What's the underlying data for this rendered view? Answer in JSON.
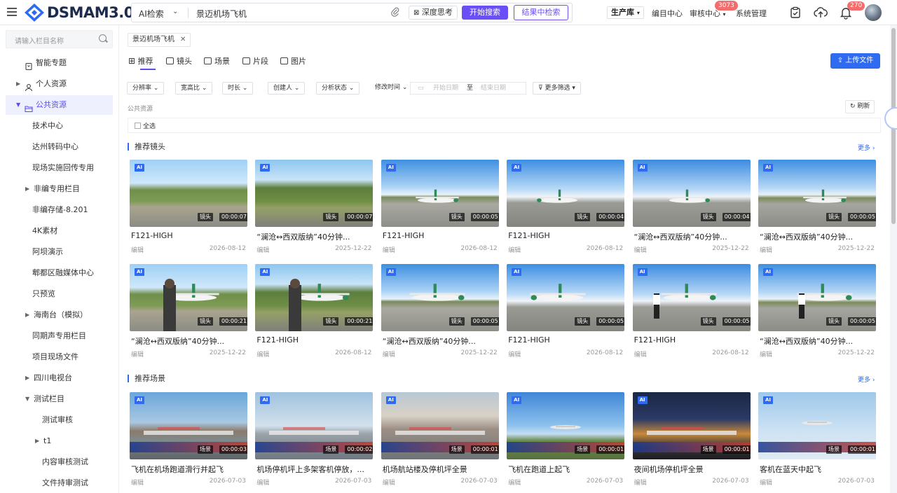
{
  "header": {
    "logo_text": "DSMAM3.0",
    "search_type": "AI检索",
    "search_value": "景迈机场飞机",
    "deep_think": "深度思考",
    "start_search": "开始搜索",
    "search_within": "结果中检索",
    "library": "生产库",
    "nav": [
      "编目中心",
      "审核中心",
      "系统管理"
    ],
    "audit_badge": "3073",
    "bell_badge": "270"
  },
  "sidebar": {
    "search_placeholder": "请输入栏目名称",
    "items": [
      {
        "label": "智能专题"
      },
      {
        "label": "个人资源"
      },
      {
        "label": "公共资源"
      },
      {
        "label": "技术中心"
      },
      {
        "label": "达州转码中心"
      },
      {
        "label": "现场实施回传专用"
      },
      {
        "label": "非编专用栏目"
      },
      {
        "label": "非编存储-8.201"
      },
      {
        "label": "4K素材"
      },
      {
        "label": "阿坝演示"
      },
      {
        "label": "郫都区融媒体中心"
      },
      {
        "label": "只预览"
      },
      {
        "label": "海南台（模拟）"
      },
      {
        "label": "同期声专用栏目"
      },
      {
        "label": "项目现场文件"
      },
      {
        "label": "四川电视台"
      },
      {
        "label": "测试栏目"
      },
      {
        "label": "测试审核"
      },
      {
        "label": "t1"
      },
      {
        "label": "内容审核测试"
      },
      {
        "label": "文件持审测试"
      }
    ]
  },
  "main": {
    "tag": "景迈机场飞机",
    "tabs": [
      "推荐",
      "镜头",
      "场景",
      "片段",
      "图片"
    ],
    "upload": "上传文件",
    "filters": [
      "分辨率",
      "宽高比",
      "时长",
      "创建人",
      "分析状态",
      "修改时间",
      "更多筛选"
    ],
    "date_start": "开始日期",
    "date_to": "至",
    "date_end": "结束日期",
    "crumb": "公共资源",
    "refresh": "刷新",
    "select_all": "全选",
    "more": "更多",
    "sections": [
      {
        "title": "推荐镜头",
        "cards": [
          {
            "title": "F121-HIGH",
            "user": "编辑",
            "date": "2026-08-12",
            "kind": "镜头",
            "duration": "00:00:07"
          },
          {
            "title": "“澜沧↔西双版纳”40分钟...",
            "user": "编辑",
            "date": "2025-12-22",
            "kind": "镜头",
            "duration": "00:00:07"
          },
          {
            "title": "F121-HIGH",
            "user": "编辑",
            "date": "2026-08-12",
            "kind": "镜头",
            "duration": "00:00:05"
          },
          {
            "title": "F121-HIGH",
            "user": "编辑",
            "date": "2026-08-12",
            "kind": "镜头",
            "duration": "00:00:04"
          },
          {
            "title": "“澜沧↔西双版纳”40分钟...",
            "user": "编辑",
            "date": "2025-12-22",
            "kind": "镜头",
            "duration": "00:00:04"
          },
          {
            "title": "“澜沧↔西双版纳”40分钟...",
            "user": "编辑",
            "date": "2025-12-22",
            "kind": "镜头",
            "duration": "00:00:05"
          },
          {
            "title": "“澜沧↔西双版纳”40分钟...",
            "user": "编辑",
            "date": "2025-12-22",
            "kind": "镜头",
            "duration": "00:00:21"
          },
          {
            "title": "F121-HIGH",
            "user": "编辑",
            "date": "2026-08-12",
            "kind": "镜头",
            "duration": "00:00:21"
          },
          {
            "title": "“澜沧↔西双版纳”40分钟...",
            "user": "编辑",
            "date": "2025-12-22",
            "kind": "镜头",
            "duration": "00:00:05"
          },
          {
            "title": "F121-HIGH",
            "user": "编辑",
            "date": "2026-08-12",
            "kind": "镜头",
            "duration": "00:00:05"
          },
          {
            "title": "F121-HIGH",
            "user": "编辑",
            "date": "2026-08-12",
            "kind": "镜头",
            "duration": "00:00:05"
          },
          {
            "title": "“澜沧↔西双版纳”40分钟...",
            "user": "编辑",
            "date": "2025-12-22",
            "kind": "镜头",
            "duration": "00:00:05"
          }
        ]
      },
      {
        "title": "推荐场景",
        "cards": [
          {
            "title": "飞机在机场跑道滑行并起飞",
            "user": "编辑",
            "date": "2026-07-03",
            "kind": "场景",
            "duration": "00:00:03"
          },
          {
            "title": "机场停机坪上多架客机停放，...",
            "user": "编辑",
            "date": "2026-07-03",
            "kind": "场景",
            "duration": "00:00:02"
          },
          {
            "title": "机场航站楼及停机坪全景",
            "user": "编辑",
            "date": "2026-07-03",
            "kind": "场景",
            "duration": "00:00:01"
          },
          {
            "title": "飞机在跑道上起飞",
            "user": "编辑",
            "date": "2026-07-03",
            "kind": "场景",
            "duration": "00:00:01"
          },
          {
            "title": "夜间机场停机坪全景",
            "user": "编辑",
            "date": "2026-07-03",
            "kind": "场景",
            "duration": "00:00:01"
          },
          {
            "title": "客机在蓝天中起飞",
            "user": "编辑",
            "date": "2026-07-03",
            "kind": "场景",
            "duration": "00:00:01"
          }
        ]
      }
    ]
  }
}
